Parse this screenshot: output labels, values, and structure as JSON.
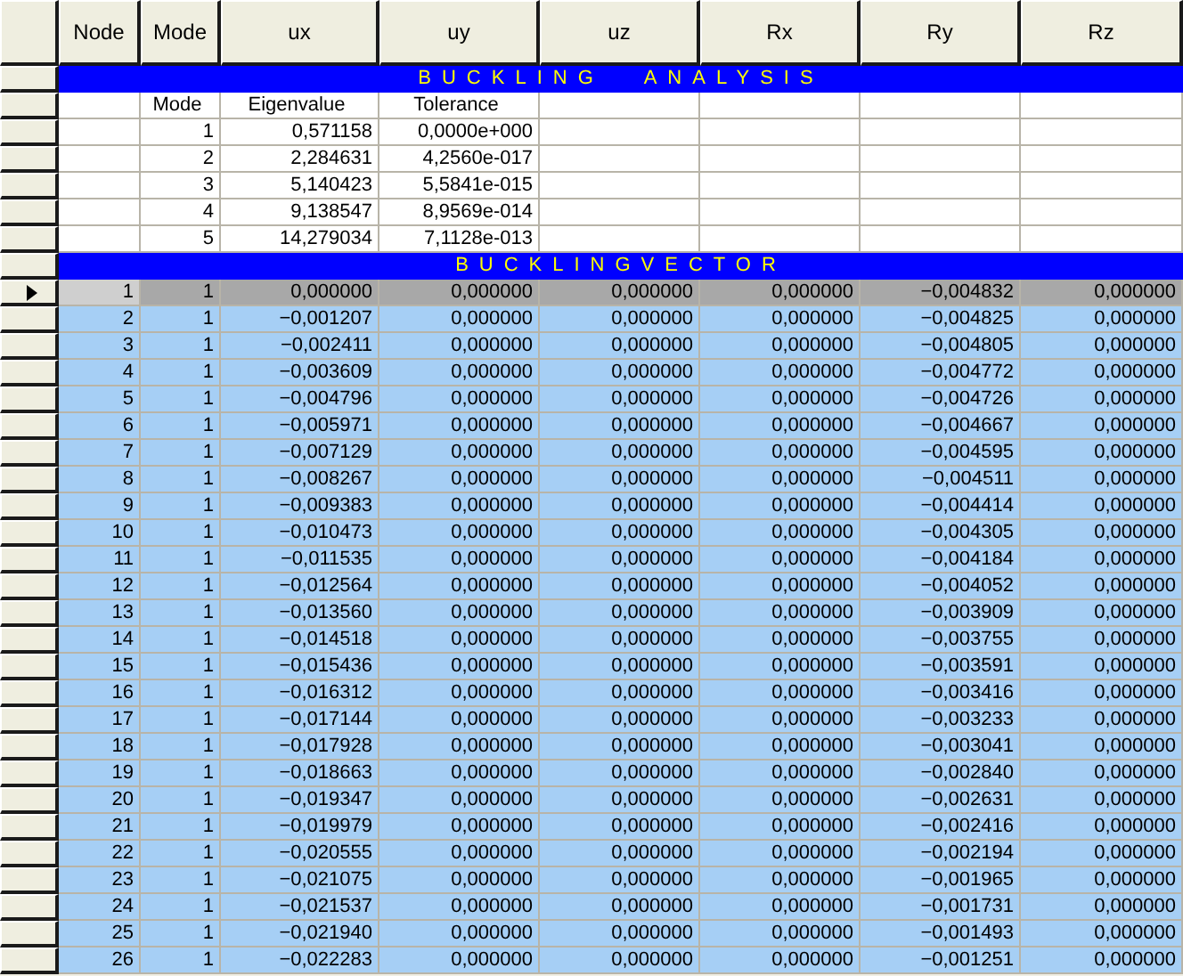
{
  "columns": [
    "Node",
    "Mode",
    "ux",
    "uy",
    "uz",
    "Rx",
    "Ry",
    "Rz"
  ],
  "buckling_analysis": {
    "title": "BUCKLING ANALYSIS",
    "headers": [
      "Mode",
      "Eigenvalue",
      "Tolerance"
    ],
    "rows": [
      {
        "mode": "1",
        "eigenvalue": "0,571158",
        "tolerance": "0,0000e+000"
      },
      {
        "mode": "2",
        "eigenvalue": "2,284631",
        "tolerance": "4,2560e-017"
      },
      {
        "mode": "3",
        "eigenvalue": "5,140423",
        "tolerance": "5,5841e-015"
      },
      {
        "mode": "4",
        "eigenvalue": "9,138547",
        "tolerance": "8,9569e-014"
      },
      {
        "mode": "5",
        "eigenvalue": "14,279034",
        "tolerance": "7,1128e-013"
      }
    ]
  },
  "buckling_vector": {
    "title": "BUCKLINGVECTOR",
    "rows": [
      {
        "node": "1",
        "mode": "1",
        "ux": "0,000000",
        "uy": "0,000000",
        "uz": "0,000000",
        "rx": "0,000000",
        "ry": "−0,004832",
        "rz": "0,000000",
        "selected": true
      },
      {
        "node": "2",
        "mode": "1",
        "ux": "−0,001207",
        "uy": "0,000000",
        "uz": "0,000000",
        "rx": "0,000000",
        "ry": "−0,004825",
        "rz": "0,000000",
        "selected": false
      },
      {
        "node": "3",
        "mode": "1",
        "ux": "−0,002411",
        "uy": "0,000000",
        "uz": "0,000000",
        "rx": "0,000000",
        "ry": "−0,004805",
        "rz": "0,000000",
        "selected": false
      },
      {
        "node": "4",
        "mode": "1",
        "ux": "−0,003609",
        "uy": "0,000000",
        "uz": "0,000000",
        "rx": "0,000000",
        "ry": "−0,004772",
        "rz": "0,000000",
        "selected": false
      },
      {
        "node": "5",
        "mode": "1",
        "ux": "−0,004796",
        "uy": "0,000000",
        "uz": "0,000000",
        "rx": "0,000000",
        "ry": "−0,004726",
        "rz": "0,000000",
        "selected": false
      },
      {
        "node": "6",
        "mode": "1",
        "ux": "−0,005971",
        "uy": "0,000000",
        "uz": "0,000000",
        "rx": "0,000000",
        "ry": "−0,004667",
        "rz": "0,000000",
        "selected": false
      },
      {
        "node": "7",
        "mode": "1",
        "ux": "−0,007129",
        "uy": "0,000000",
        "uz": "0,000000",
        "rx": "0,000000",
        "ry": "−0,004595",
        "rz": "0,000000",
        "selected": false
      },
      {
        "node": "8",
        "mode": "1",
        "ux": "−0,008267",
        "uy": "0,000000",
        "uz": "0,000000",
        "rx": "0,000000",
        "ry": "−0,004511",
        "rz": "0,000000",
        "selected": false
      },
      {
        "node": "9",
        "mode": "1",
        "ux": "−0,009383",
        "uy": "0,000000",
        "uz": "0,000000",
        "rx": "0,000000",
        "ry": "−0,004414",
        "rz": "0,000000",
        "selected": false
      },
      {
        "node": "10",
        "mode": "1",
        "ux": "−0,010473",
        "uy": "0,000000",
        "uz": "0,000000",
        "rx": "0,000000",
        "ry": "−0,004305",
        "rz": "0,000000",
        "selected": false
      },
      {
        "node": "11",
        "mode": "1",
        "ux": "−0,011535",
        "uy": "0,000000",
        "uz": "0,000000",
        "rx": "0,000000",
        "ry": "−0,004184",
        "rz": "0,000000",
        "selected": false
      },
      {
        "node": "12",
        "mode": "1",
        "ux": "−0,012564",
        "uy": "0,000000",
        "uz": "0,000000",
        "rx": "0,000000",
        "ry": "−0,004052",
        "rz": "0,000000",
        "selected": false
      },
      {
        "node": "13",
        "mode": "1",
        "ux": "−0,013560",
        "uy": "0,000000",
        "uz": "0,000000",
        "rx": "0,000000",
        "ry": "−0,003909",
        "rz": "0,000000",
        "selected": false
      },
      {
        "node": "14",
        "mode": "1",
        "ux": "−0,014518",
        "uy": "0,000000",
        "uz": "0,000000",
        "rx": "0,000000",
        "ry": "−0,003755",
        "rz": "0,000000",
        "selected": false
      },
      {
        "node": "15",
        "mode": "1",
        "ux": "−0,015436",
        "uy": "0,000000",
        "uz": "0,000000",
        "rx": "0,000000",
        "ry": "−0,003591",
        "rz": "0,000000",
        "selected": false
      },
      {
        "node": "16",
        "mode": "1",
        "ux": "−0,016312",
        "uy": "0,000000",
        "uz": "0,000000",
        "rx": "0,000000",
        "ry": "−0,003416",
        "rz": "0,000000",
        "selected": false
      },
      {
        "node": "17",
        "mode": "1",
        "ux": "−0,017144",
        "uy": "0,000000",
        "uz": "0,000000",
        "rx": "0,000000",
        "ry": "−0,003233",
        "rz": "0,000000",
        "selected": false
      },
      {
        "node": "18",
        "mode": "1",
        "ux": "−0,017928",
        "uy": "0,000000",
        "uz": "0,000000",
        "rx": "0,000000",
        "ry": "−0,003041",
        "rz": "0,000000",
        "selected": false
      },
      {
        "node": "19",
        "mode": "1",
        "ux": "−0,018663",
        "uy": "0,000000",
        "uz": "0,000000",
        "rx": "0,000000",
        "ry": "−0,002840",
        "rz": "0,000000",
        "selected": false
      },
      {
        "node": "20",
        "mode": "1",
        "ux": "−0,019347",
        "uy": "0,000000",
        "uz": "0,000000",
        "rx": "0,000000",
        "ry": "−0,002631",
        "rz": "0,000000",
        "selected": false
      },
      {
        "node": "21",
        "mode": "1",
        "ux": "−0,019979",
        "uy": "0,000000",
        "uz": "0,000000",
        "rx": "0,000000",
        "ry": "−0,002416",
        "rz": "0,000000",
        "selected": false
      },
      {
        "node": "22",
        "mode": "1",
        "ux": "−0,020555",
        "uy": "0,000000",
        "uz": "0,000000",
        "rx": "0,000000",
        "ry": "−0,002194",
        "rz": "0,000000",
        "selected": false
      },
      {
        "node": "23",
        "mode": "1",
        "ux": "−0,021075",
        "uy": "0,000000",
        "uz": "0,000000",
        "rx": "0,000000",
        "ry": "−0,001965",
        "rz": "0,000000",
        "selected": false
      },
      {
        "node": "24",
        "mode": "1",
        "ux": "−0,021537",
        "uy": "0,000000",
        "uz": "0,000000",
        "rx": "0,000000",
        "ry": "−0,001731",
        "rz": "0,000000",
        "selected": false
      },
      {
        "node": "25",
        "mode": "1",
        "ux": "−0,021940",
        "uy": "0,000000",
        "uz": "0,000000",
        "rx": "0,000000",
        "ry": "−0,001493",
        "rz": "0,000000",
        "selected": false
      },
      {
        "node": "26",
        "mode": "1",
        "ux": "−0,022283",
        "uy": "0,000000",
        "uz": "0,000000",
        "rx": "0,000000",
        "ry": "−0,001251",
        "rz": "0,000000",
        "selected": false
      }
    ]
  }
}
